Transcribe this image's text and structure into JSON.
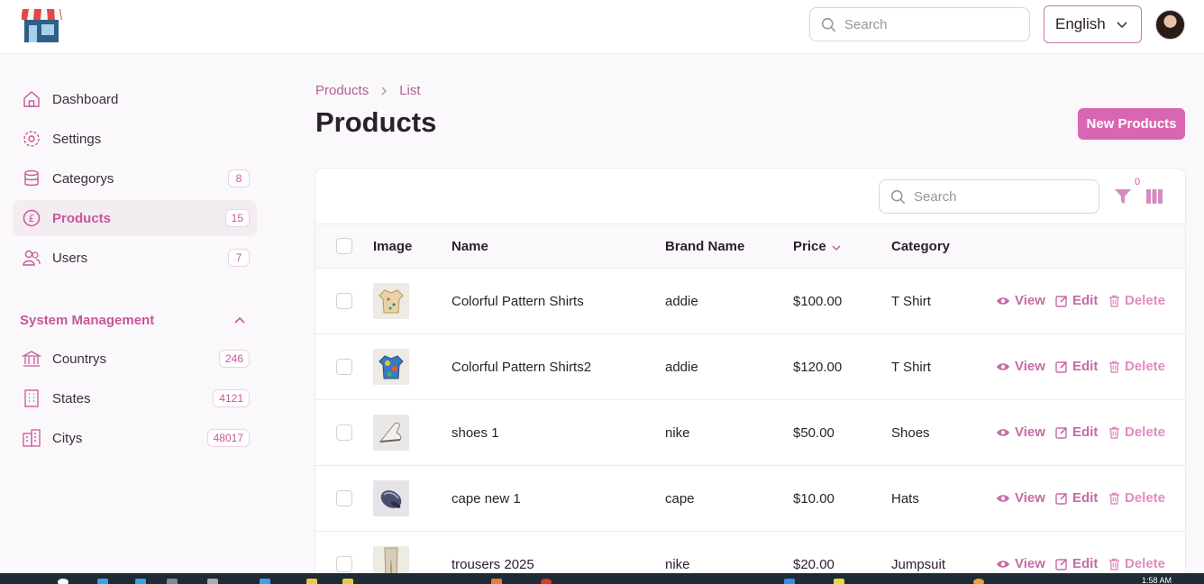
{
  "header": {
    "search_placeholder": "Search",
    "language": "English"
  },
  "sidebar": {
    "items": [
      {
        "label": "Dashboard",
        "badge": null
      },
      {
        "label": "Settings",
        "badge": null
      },
      {
        "label": "Categorys",
        "badge": "8"
      },
      {
        "label": "Products",
        "badge": "15"
      },
      {
        "label": "Users",
        "badge": "7"
      }
    ],
    "group_title": "System Management",
    "group_items": [
      {
        "label": "Countrys",
        "badge": "246"
      },
      {
        "label": "States",
        "badge": "4121"
      },
      {
        "label": "Citys",
        "badge": "48017"
      }
    ]
  },
  "breadcrumb": {
    "parent": "Products",
    "current": "List"
  },
  "page_title": "Products",
  "new_button": "New Products",
  "table": {
    "search_placeholder": "Search",
    "filter_count": "0",
    "columns": {
      "image": "Image",
      "name": "Name",
      "brand": "Brand Name",
      "price": "Price",
      "category": "Category"
    },
    "actions": {
      "view": "View",
      "edit": "Edit",
      "delete": "Delete"
    },
    "rows": [
      {
        "name": "Colorful Pattern Shirts",
        "brand": "addie",
        "price": "$100.00",
        "category": "T Shirt"
      },
      {
        "name": "Colorful Pattern Shirts2",
        "brand": "addie",
        "price": "$120.00",
        "category": "T Shirt"
      },
      {
        "name": "shoes 1",
        "brand": "nike",
        "price": "$50.00",
        "category": "Shoes"
      },
      {
        "name": "cape new 1",
        "brand": "cape",
        "price": "$10.00",
        "category": "Hats"
      },
      {
        "name": "trousers 2025",
        "brand": "nike",
        "price": "$20.00",
        "category": "Jumpsuit"
      }
    ]
  },
  "taskbar": {
    "clock": "1:58 AM"
  },
  "colors": {
    "accent": "#d966b2",
    "accent_text": "#c9569c",
    "active_bg": "#f3ecf1"
  }
}
